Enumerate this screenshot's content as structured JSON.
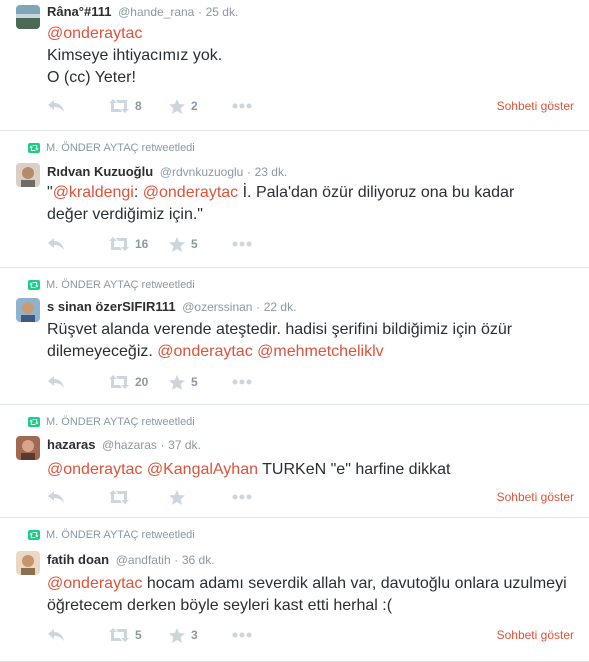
{
  "colors": {
    "link": "#e0523a",
    "muted": "#8899a6",
    "retweet_green": "#19cf86",
    "text": "#292f33"
  },
  "tweets": [
    {
      "retweeted_by": "",
      "name": "Râna°#111",
      "handle": "@hande_rana",
      "sep": "·",
      "time": "25 dk.",
      "mention1": "@onderaytac",
      "line1": "Kimseye ihtiyacımız yok.",
      "line2": "O (cc) Yeter!",
      "retweets": "8",
      "favorites": "2",
      "show_convo": "Sohbeti göster"
    },
    {
      "retweeted_by": "M. ÖNDER AYTAÇ retweetledi",
      "name": "Rıdvan Kuzuoğlu",
      "handle": "@rdvnkuzuoglu",
      "sep": "·",
      "time": "23 dk.",
      "q_open": "\"",
      "mention1": "@kraldengi",
      "colon": ": ",
      "mention2": "@onderaytac",
      "rest": " İ. Pala'dan özür diliyoruz ona bu kadar değer verdiğimiz için.\"",
      "retweets": "16",
      "favorites": "5"
    },
    {
      "retweeted_by": "M. ÖNDER AYTAÇ retweetledi",
      "name": "s sinan özerSIFIR111",
      "handle": "@ozerssinan",
      "sep": "·",
      "time": "22 dk.",
      "text": "Rüşvet alanda verende ateştedir. hadisi şerifini bildiğimiz için özür dilemeyeceğiz. ",
      "mention1": "@onderaytac",
      "mention2": "@mehmetcheliklv",
      "retweets": "20",
      "favorites": "5"
    },
    {
      "retweeted_by": "M. ÖNDER AYTAÇ retweetledi",
      "name": "hazaras",
      "handle": "@hazaras",
      "sep": "·",
      "time": "37 dk.",
      "mention1": "@onderaytac",
      "mention2": "@KangalAyhan",
      "rest": " TURKeN \"e\" harfine dikkat",
      "show_convo": "Sohbeti göster"
    },
    {
      "retweeted_by": "M. ÖNDER AYTAÇ retweetledi",
      "name": "fatih doan",
      "handle": "@andfatih",
      "sep": "·",
      "time": "36 dk.",
      "mention1": "@onderaytac",
      "rest": " hocam adamı severdik allah var, davutoğlu onlara uzulmeyi öğretecem derken böyle seyleri kast etti herhal :(",
      "retweets": "5",
      "favorites": "3",
      "show_convo": "Sohbeti göster"
    }
  ]
}
